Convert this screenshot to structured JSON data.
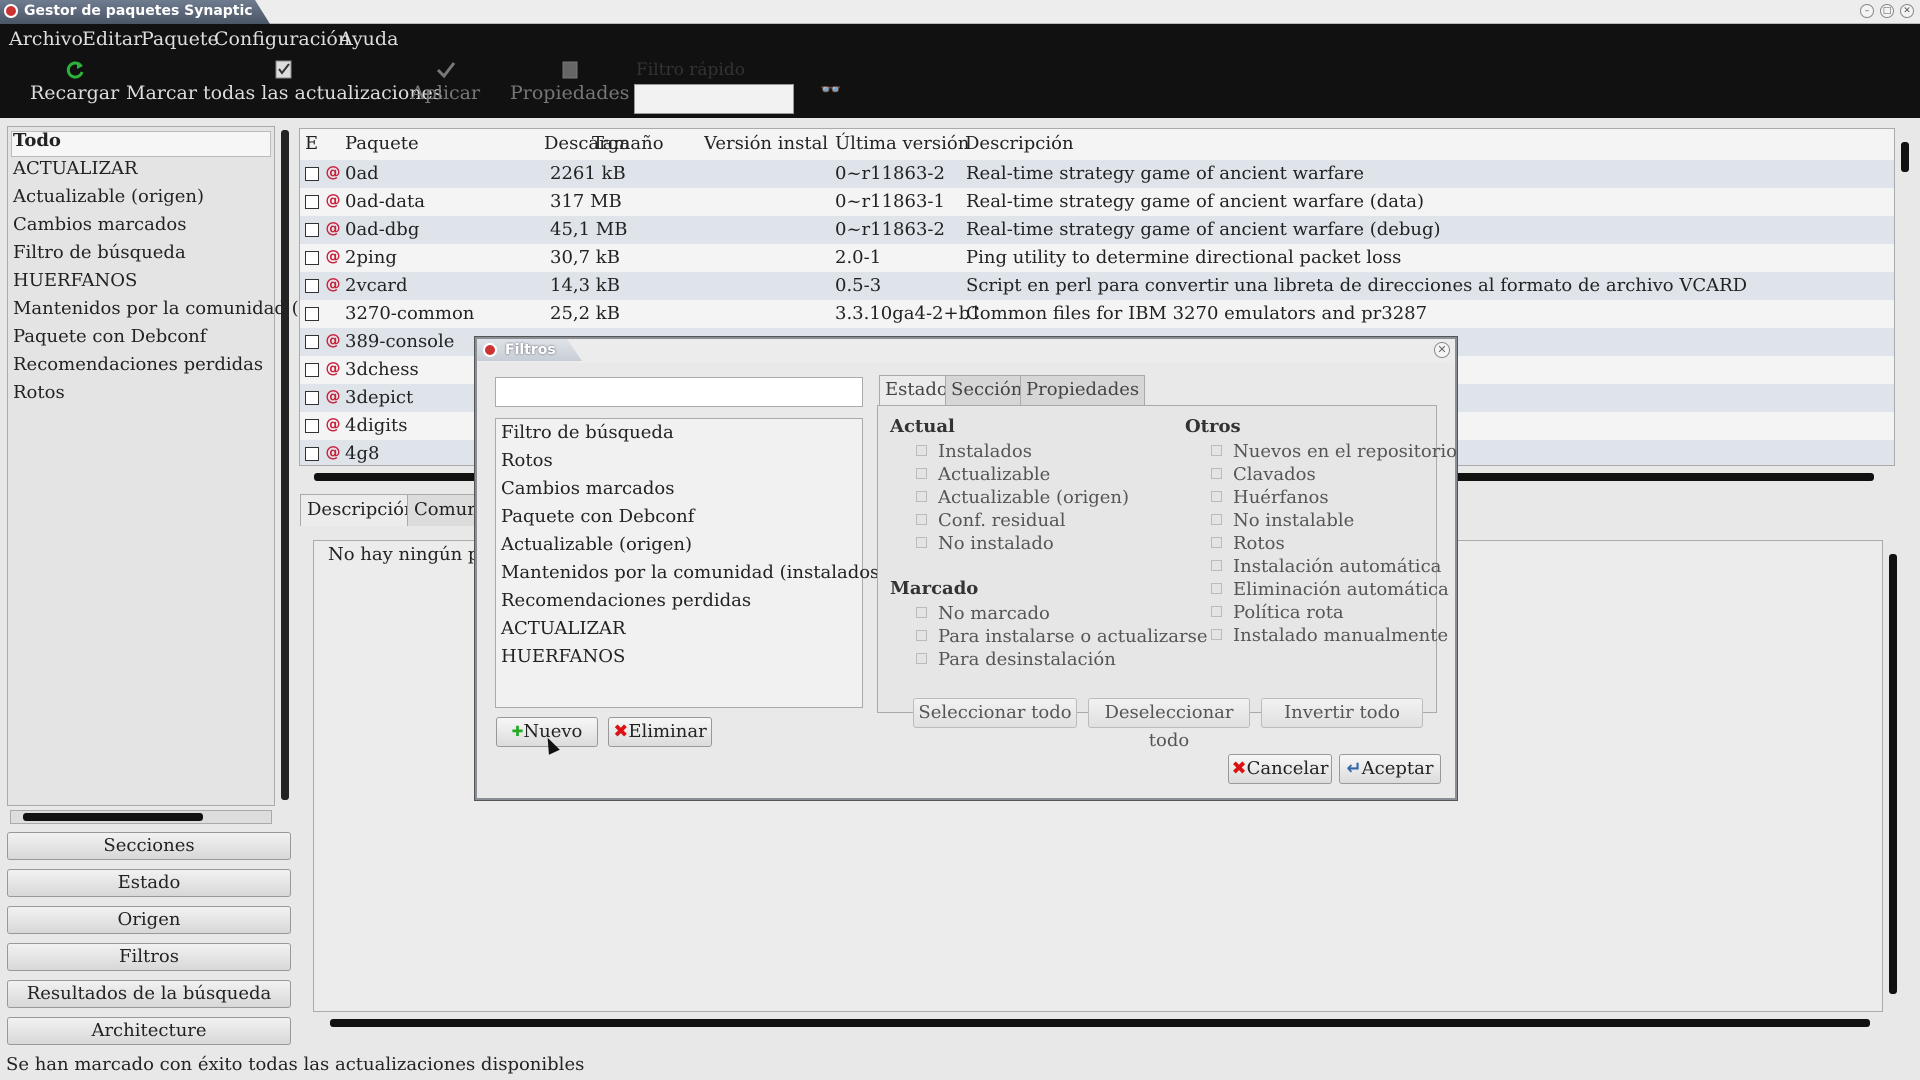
{
  "window": {
    "title": "Gestor de paquetes Synaptic"
  },
  "menu": [
    "Archivo",
    "Editar",
    "Paquete",
    "Configuración",
    "Ayuda"
  ],
  "toolbar": {
    "reload": "Recargar",
    "mark_all": "Marcar todas las actualizaciones",
    "apply": "Aplicar",
    "properties": "Propiedades",
    "quick_filter": "Filtro rápido"
  },
  "left_panel": {
    "items": [
      "Todo",
      "ACTUALIZAR",
      "Actualizable (origen)",
      "Cambios marcados",
      "Filtro de búsqueda",
      "HUERFANOS",
      "Mantenidos por la comunidad (in",
      "Paquete con Debconf",
      "Recomendaciones perdidas",
      "Rotos"
    ]
  },
  "category_buttons": [
    "Secciones",
    "Estado",
    "Origen",
    "Filtros",
    "Resultados de la búsqueda",
    "Architecture"
  ],
  "table": {
    "headers": [
      "E",
      "Paquete",
      "Descarga",
      "Tamaño",
      "Versión instalad",
      "Última versión",
      "Descripción"
    ],
    "rows": [
      {
        "name": "0ad",
        "download": "2261 kB",
        "version": "0~r11863-2",
        "description": "Real-time strategy game of ancient warfare"
      },
      {
        "name": "0ad-data",
        "download": "317 MB",
        "version": "0~r11863-1",
        "description": "Real-time strategy game of ancient warfare (data)"
      },
      {
        "name": "0ad-dbg",
        "download": "45,1 MB",
        "version": "0~r11863-2",
        "description": "Real-time strategy game of ancient warfare (debug)"
      },
      {
        "name": "2ping",
        "download": "30,7 kB",
        "version": "2.0-1",
        "description": "Ping utility to determine directional packet loss"
      },
      {
        "name": "2vcard",
        "download": "14,3 kB",
        "version": "0.5-3",
        "description": "Script en perl para convertir una libreta de direcciones al formato de archivo VCARD"
      },
      {
        "name": "3270-common",
        "download": "25,2 kB",
        "version": "3.3.10ga4-2+b1",
        "description": "Common files for IBM 3270 emulators and pr3287"
      },
      {
        "name": "389-console",
        "download": "",
        "version": "",
        "description": ""
      },
      {
        "name": "3dchess",
        "download": "",
        "version": "",
        "description": ""
      },
      {
        "name": "3depict",
        "download": "",
        "version": "",
        "description": ""
      },
      {
        "name": "4digits",
        "download": "",
        "version": "",
        "description": ""
      },
      {
        "name": "4g8",
        "download": "",
        "version": "",
        "description": ""
      }
    ]
  },
  "detail": {
    "tabs": [
      "Descripción",
      "Comun"
    ],
    "text": "No hay ningún pa"
  },
  "status_bar": "Se han marcado con éxito todas las actualizaciones disponibles",
  "dialog": {
    "title": "Filtros",
    "filters": [
      "Filtro de búsqueda",
      "Rotos",
      "Cambios marcados",
      "Paquete con Debconf",
      "Actualizable (origen)",
      "Mantenidos por la comunidad (instalados)",
      "Recomendaciones perdidas",
      "ACTUALIZAR",
      "HUERFANOS"
    ],
    "new_button": "Nuevo",
    "delete_button": "Eliminar",
    "tabs": [
      "Estado",
      "Sección",
      "Propiedades"
    ],
    "actual_title": "Actual",
    "actual": [
      "Instalados",
      "Actualizable",
      "Actualizable (origen)",
      "Conf. residual",
      "No instalado"
    ],
    "marked_title": "Marcado",
    "marked": [
      "No marcado",
      "Para instalarse o actualizarse",
      "Para desinstalación"
    ],
    "others_title": "Otros",
    "others": [
      "Nuevos en el repositorio",
      "Clavados",
      "Huérfanos",
      "No instalable",
      "Rotos",
      "Instalación automática",
      "Eliminación automática",
      "Política rota",
      "Instalado manualmente"
    ],
    "select_all": "Seleccionar todo",
    "deselect_all": "Deseleccionar todo",
    "invert_all": "Invertir todo",
    "cancel": "Cancelar",
    "accept": "Aceptar"
  }
}
